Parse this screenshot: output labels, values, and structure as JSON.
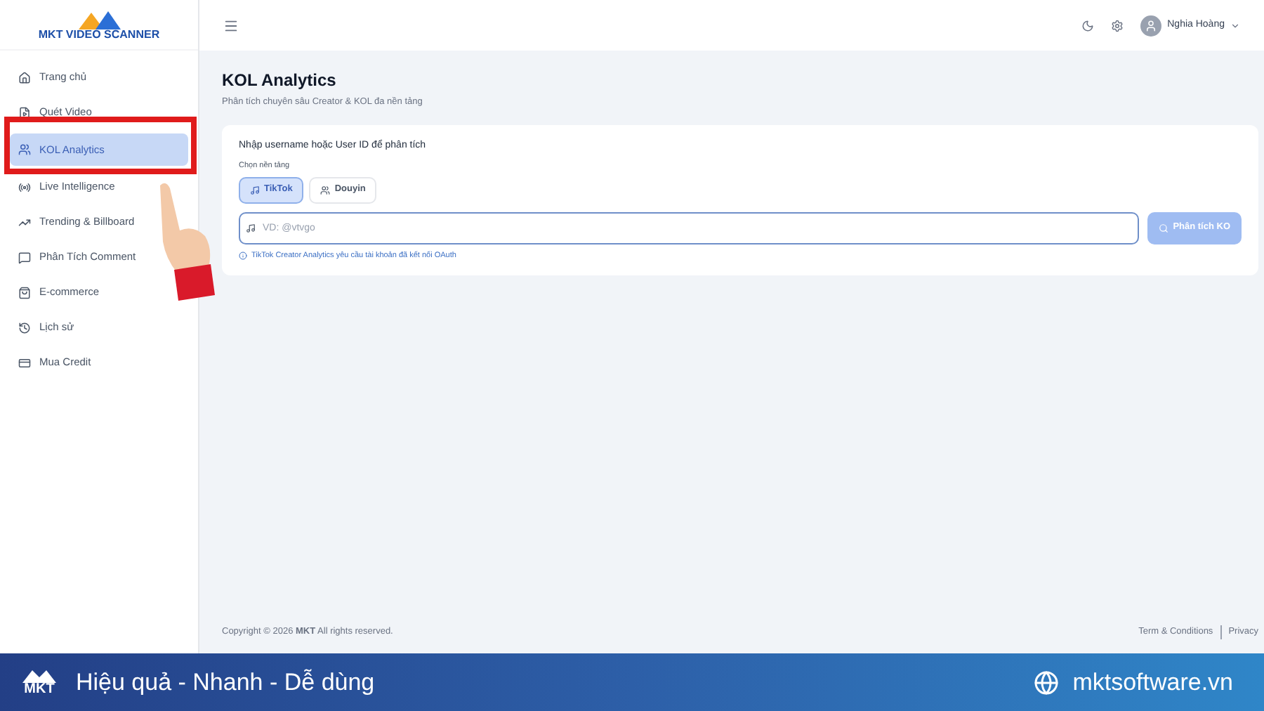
{
  "logo": {
    "text": "MKT VIDEO SCANNER"
  },
  "sidebar": {
    "items": [
      {
        "label": "Trang chủ",
        "selected": false
      },
      {
        "label": "Quét Video",
        "selected": false
      },
      {
        "label": "KOL Analytics",
        "selected": true
      },
      {
        "label": "Live Intelligence",
        "selected": false
      },
      {
        "label": "Trending & Billboard",
        "selected": false
      },
      {
        "label": "Phân Tích Comment",
        "selected": false
      },
      {
        "label": "E-commerce",
        "selected": false
      },
      {
        "label": "Lịch sử",
        "selected": false
      },
      {
        "label": "Mua Credit",
        "selected": false
      }
    ]
  },
  "header": {
    "user": "Nghia Hoàng"
  },
  "page": {
    "title": "KOL Analytics",
    "subtitle": "Phân tích chuyên sâu Creator & KOL đa nền tảng"
  },
  "form": {
    "heading": "Nhập username hoặc User ID để phân tích",
    "platform_label": "Chọn nền tảng",
    "platforms": [
      {
        "label": "TikTok",
        "selected": true
      },
      {
        "label": "Douyin",
        "selected": false
      }
    ],
    "input": {
      "placeholder": "VD: @vtvgo"
    },
    "submit": {
      "label": "Phân tích KO",
      "disabled": true
    },
    "note": "TikTok Creator Analytics yêu cầu tài khoản đã kết nối OAuth"
  },
  "footer": {
    "copyright": "Copyright © 2026 **MKT** All rights reserved.",
    "links": [
      "Term & Conditions",
      "Privacy"
    ]
  },
  "banner": {
    "logo": "MKT",
    "slogan": "Hiệu quả - Nhanh - Dễ dùng",
    "website": "mktsoftware.vn"
  }
}
